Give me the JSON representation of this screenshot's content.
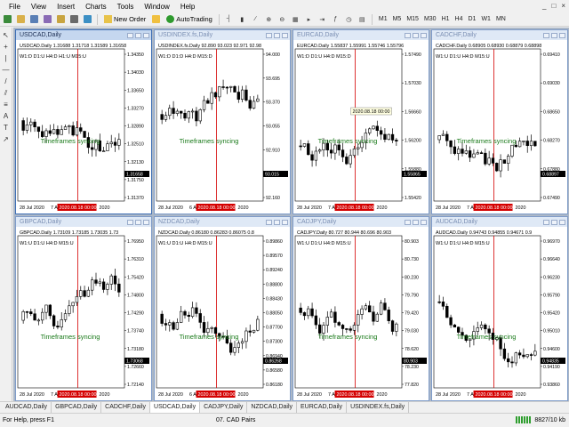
{
  "menu": [
    "File",
    "View",
    "Insert",
    "Charts",
    "Tools",
    "Window",
    "Help"
  ],
  "window_controls": [
    "_",
    "□",
    "×"
  ],
  "toolbar": {
    "new_order": "New Order",
    "autotrading": "AutoTrading",
    "timeframes": [
      "M1",
      "M5",
      "M15",
      "M30",
      "H1",
      "H4",
      "D1",
      "W1",
      "MN"
    ]
  },
  "left_tools": [
    "cursor-icon",
    "crosshair-icon",
    "vertical-line-icon",
    "horizontal-line-icon",
    "trendline-icon",
    "channel-icon",
    "fibo-icon",
    "text-icon",
    "label-icon",
    "arrow-icon"
  ],
  "sync_label": "Timeframes syncing",
  "tf_row": "W1:U  D1:U  H4:D  M15:U",
  "highlight_date": "2020.08.18 00:00",
  "charts": [
    {
      "title": "USDCAD,Daily",
      "info": "USDCAD.Daily 1.31688 1.31718 1.31589 1.31658",
      "tf_row": "W1:D  D1:U  H4:D  H1:U  M15:U",
      "prices": [
        "1.34350",
        "1.34030",
        "1.33650",
        "1.33270",
        "1.32890",
        "1.32510",
        "1.32130",
        "1.31750",
        "1.31370"
      ],
      "current_price": "1.31658",
      "x_labels": [
        "28 Jul 2020",
        "7 Aug 2020",
        "2020.08.18 00:00",
        "2020"
      ],
      "active": true
    },
    {
      "title": "USDINDEX.fs,Daily",
      "info": "USDINDEX.fs.Daily 92.890 93.023 92.971 92.98",
      "tf_row": "W1:D  D1:D  H4:D  M15:D",
      "prices": [
        "94.000",
        "93.695",
        "93.370",
        "93.055",
        "92.910",
        "92.510",
        "92.160"
      ],
      "current_price": "93.015",
      "x_labels": [
        "28 Jul 2020",
        "6 Aug",
        "2020.08.18 00:00",
        "2020"
      ],
      "active": false
    },
    {
      "title": "EURCAD,Daily",
      "info": "EURCAD.Daily 1.55837 1.55991 1.55746 1.55796",
      "tf_row": "W1:D  D1:U  H4:D  M15:D",
      "prices": [
        "1.57490",
        "1.57030",
        "1.56660",
        "1.56200",
        "1.55880",
        "1.55420"
      ],
      "current_price": "1.55865",
      "x_labels": [
        "28 Jul 2020",
        "7 Aug",
        "2020.08.18 00:00",
        "2020"
      ],
      "tooltip": "2020.08.18 00:00",
      "active": false
    },
    {
      "title": "CADCHF,Daily",
      "info": "CADCHF.Daily 0.68905 0.68930 0.68879 0.68898",
      "tf_row": "W1:U  D1:U  H4:D  M15:U",
      "prices": [
        "0.69410",
        "0.69030",
        "0.68650",
        "0.68270",
        "0.67880",
        "0.67490"
      ],
      "current_price": "0.68897",
      "x_labels": [
        "28 Jul 2020",
        "7 Aug",
        "2020.08.18 00:00",
        "2020"
      ],
      "active": false
    },
    {
      "title": "GBPCAD,Daily",
      "info": "GBPCAD.Daily 1.73109 1.73185 1.73035 1.73",
      "tf_row": "W1:U  D1:U  H4:D  M15:U",
      "prices": [
        "1.76950",
        "1.76310",
        "1.75420",
        "1.74800",
        "1.74290",
        "1.73740",
        "1.73180",
        "1.72660",
        "1.72140"
      ],
      "current_price": "1.73068",
      "x_labels": [
        "28 Jul 2020",
        "7 Aug",
        "2020.08.18 00:00",
        "2020"
      ],
      "active": false
    },
    {
      "title": "NZDCAD,Daily",
      "info": "NZDCAD.Daily 0.86180 0.86283 0.86075 0.8",
      "tf_row": "W1:U  D1:U  H4:D  M15:U",
      "prices": [
        "0.89860",
        "0.89570",
        "0.89240",
        "0.88800",
        "0.88430",
        "0.88050",
        "0.87700",
        "0.87300",
        "0.86940",
        "0.86580",
        "0.86180"
      ],
      "current_price": "0.86268",
      "x_labels": [
        "28 Jul 2020",
        "6 Aug",
        "2020.08.18 00:00",
        "2020"
      ],
      "active": false
    },
    {
      "title": "CADJPY,Daily",
      "info": "CADJPY.Daily 80.727 80.944 80.696 80.903",
      "tf_row": "W1:U  D1:U  H4:D  M15:U",
      "prices": [
        "80.903",
        "80.730",
        "80.230",
        "79.790",
        "79.420",
        "79.030",
        "78.620",
        "78.230",
        "77.820"
      ],
      "current_price": "80.903",
      "x_labels": [
        "28 Jul 2020",
        "7 Aug",
        "2020.08.18 00:00",
        "2020"
      ],
      "active": false
    },
    {
      "title": "AUDCAD,Daily",
      "info": "AUDCAD.Daily 0.94743 0.94855 0.94671 0.9",
      "tf_row": "W1:U  D1:U  H4:D  M15:U",
      "prices": [
        "0.96970",
        "0.96640",
        "0.96230",
        "0.95790",
        "0.95420",
        "0.95010",
        "0.94600",
        "0.94190",
        "0.93860"
      ],
      "current_price": "0.94835",
      "x_labels": [
        "28 Jul 2020",
        "7 Aug",
        "2020.08.18 00:00",
        "2020"
      ],
      "active": false
    }
  ],
  "tabs": [
    "AUDCAD,Daily",
    "GBPCAD,Daily",
    "CADCHF,Daily",
    "USDCAD,Daily",
    "CADJPY,Daily",
    "NZDCAD,Daily",
    "EURCAD,Daily",
    "USDINDEX.fs,Daily"
  ],
  "active_tab": 3,
  "status": {
    "help": "For Help, press F1",
    "profile": "07. CAD Pairs",
    "traffic": "8827/10 kb"
  },
  "colors": {
    "up_candle": "#ffffff",
    "down_candle": "#000000",
    "sync_text": "#1a7a1a",
    "highlight": "#d40000",
    "mdi_bg": "#abb7c7"
  }
}
